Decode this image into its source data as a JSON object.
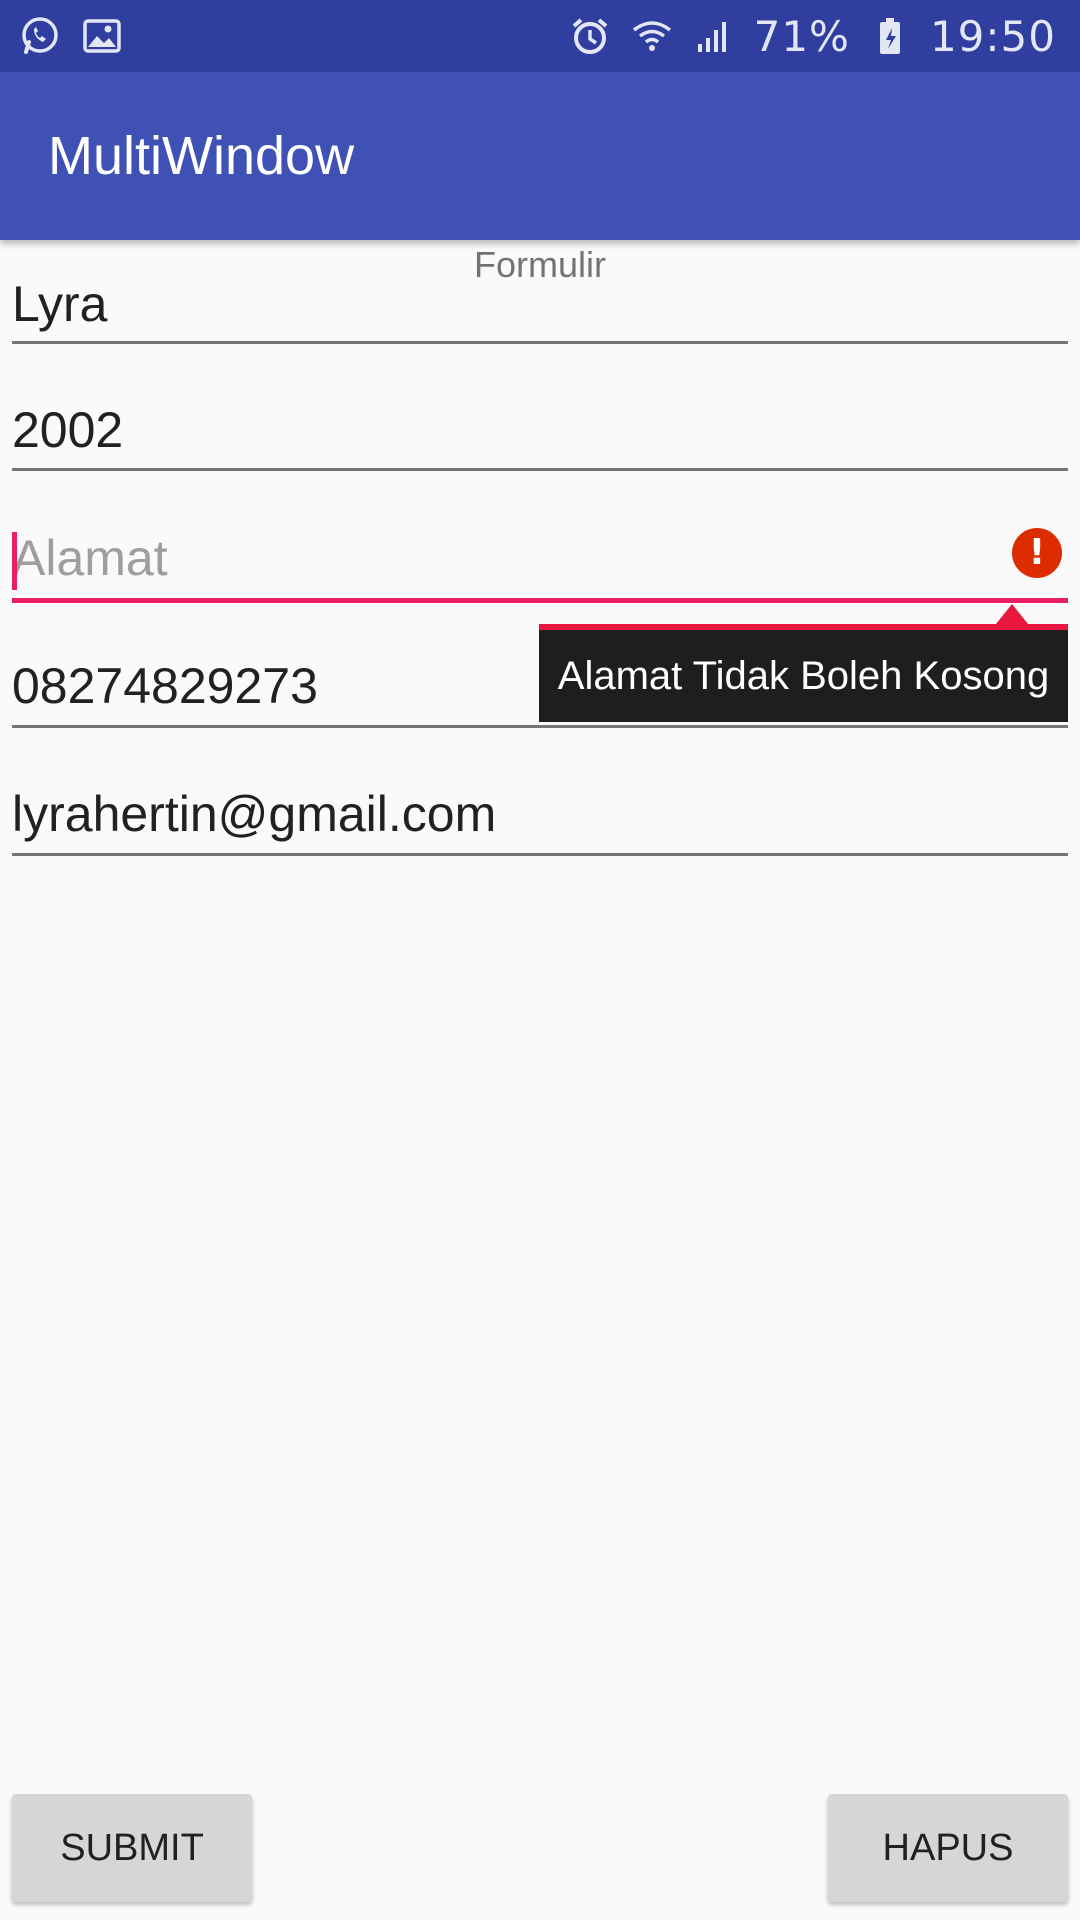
{
  "status_bar": {
    "left_icons": [
      "whatsapp-icon",
      "image-icon"
    ],
    "right_icons": [
      "alarm-icon",
      "wifi-icon",
      "signal-icon",
      "battery-charging-icon"
    ],
    "battery": "71%",
    "time": "19:50"
  },
  "app_bar": {
    "title": "MultiWindow",
    "color": "#3f51b5"
  },
  "form": {
    "title": "Formulir",
    "fields": [
      {
        "value": "Lyra"
      },
      {
        "value": "2002"
      },
      {
        "value": "",
        "placeholder": "Alamat",
        "error": "Alamat Tidak Boleh Kosong"
      },
      {
        "value": "08274829273"
      },
      {
        "value": "lyrahertin@gmail.com"
      }
    ]
  },
  "buttons": {
    "submit": "SUBMIT",
    "clear": "HAPUS"
  },
  "colors": {
    "error": "#e91e63",
    "status_bar": "#303f9f"
  }
}
